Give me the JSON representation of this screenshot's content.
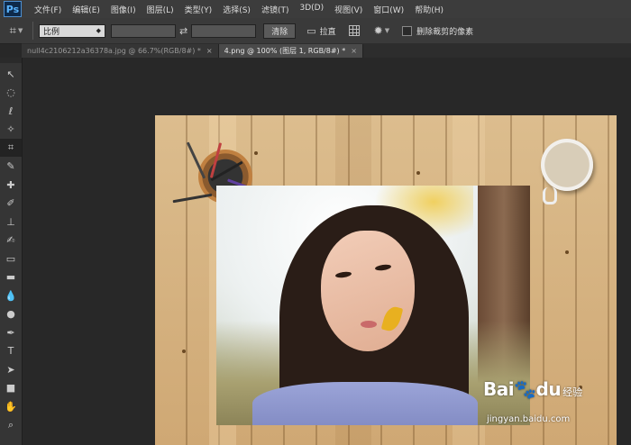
{
  "app": {
    "logo": "Ps"
  },
  "menu": [
    "文件(F)",
    "编辑(E)",
    "图像(I)",
    "图层(L)",
    "类型(Y)",
    "选择(S)",
    "滤镜(T)",
    "3D(D)",
    "视图(V)",
    "窗口(W)",
    "帮助(H)"
  ],
  "options": {
    "ratio_value": "比例",
    "clear_label": "清除",
    "straighten_label": "拉直",
    "delete_cropped_label": "删除裁剪的像素",
    "delete_cropped_checked": false
  },
  "tabs": [
    {
      "label": "null4c2106212a36378a.jpg @ 66.7%(RGB/8#) *",
      "active": false
    },
    {
      "label": "4.png @ 100% (图层 1, RGB/8#) *",
      "active": true
    }
  ],
  "tools": [
    "move-tool",
    "marquee-tool",
    "lasso-tool",
    "quick-select-tool",
    "crop-tool",
    "eyedropper-tool",
    "healing-tool",
    "brush-tool",
    "stamp-tool",
    "history-brush-tool",
    "eraser-tool",
    "gradient-tool",
    "blur-tool",
    "dodge-tool",
    "pen-tool",
    "type-tool",
    "path-select-tool",
    "shape-tool",
    "hand-tool",
    "zoom-tool"
  ],
  "tool_glyphs": [
    "↖",
    "◌",
    "ℓ",
    "✧",
    "⌗",
    "✎",
    "✚",
    "✐",
    "⊥",
    "✍",
    "▭",
    "▬",
    "💧",
    "●",
    "✒",
    "T",
    "➤",
    "■",
    "✋",
    "⌕"
  ],
  "active_tool_index": 4,
  "watermark": {
    "logo": "Bai",
    "logo_suffix": "du",
    "sub": "经验",
    "url": "jingyan.baidu.com"
  }
}
